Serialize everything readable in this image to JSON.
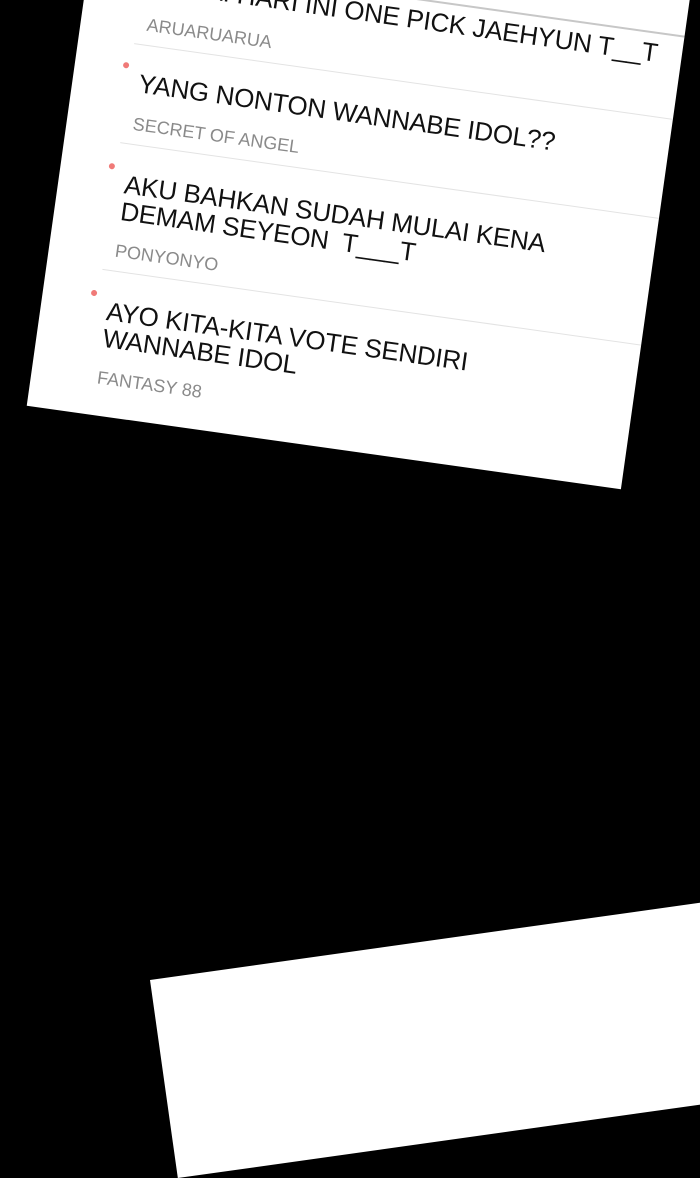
{
  "posts": [
    {
      "title": "MULAI HARI INI ONE PICK JAEHYUN T__T",
      "author": "ARUARUARUA"
    },
    {
      "title": "YANG NONTON WANNABE IDOL??",
      "author": "SECRET OF ANGEL"
    },
    {
      "title": "AKU BAHKAN SUDAH MULAI KENA\nDEMAM SEYEON  T___T",
      "author": "PONYONYO"
    },
    {
      "title": "AYO KITA-KITA VOTE SENDIRI\nWANNABE IDOL",
      "author": "FANTASY 88"
    }
  ],
  "colors": {
    "background": "#000000",
    "card": "#ffffff",
    "dot": "#f07a78",
    "author": "#8a8a8a"
  }
}
